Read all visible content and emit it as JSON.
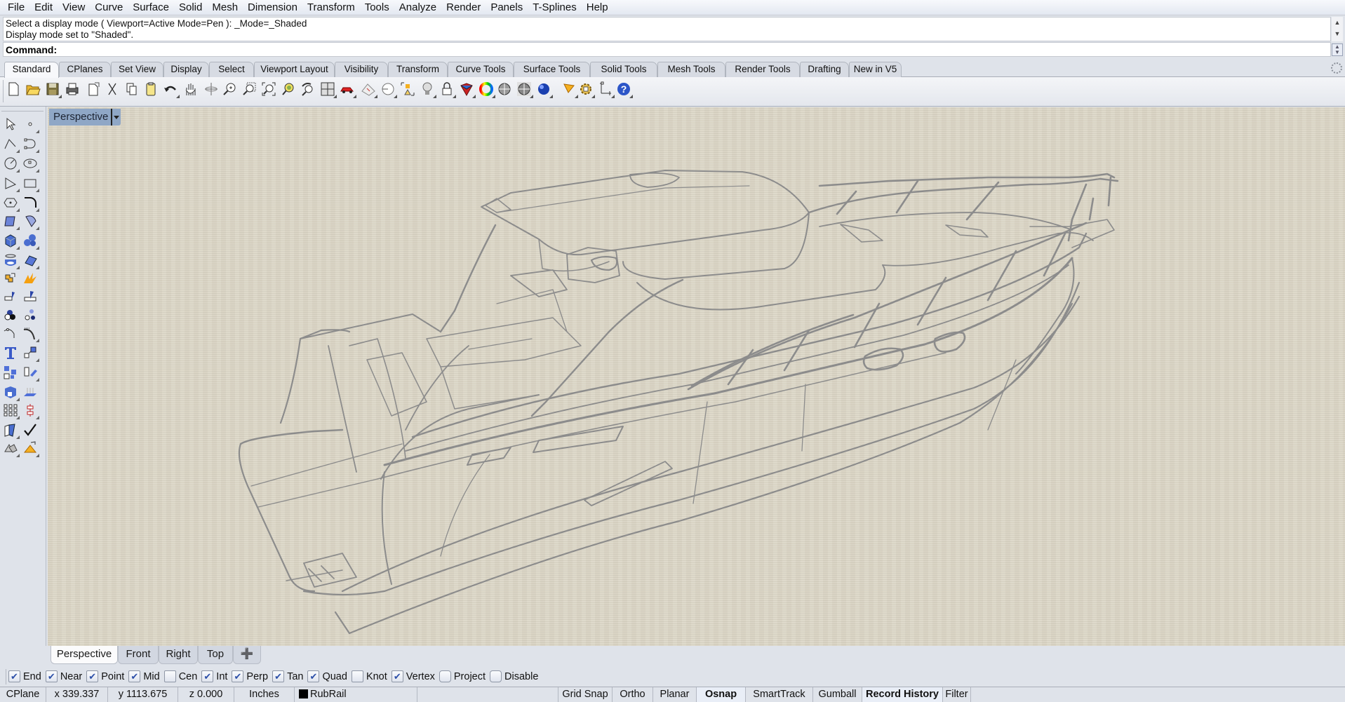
{
  "menu": [
    "File",
    "Edit",
    "View",
    "Curve",
    "Surface",
    "Solid",
    "Mesh",
    "Dimension",
    "Transform",
    "Tools",
    "Analyze",
    "Render",
    "Panels",
    "T-Splines",
    "Help"
  ],
  "command_history": [
    "Select a display mode ( Viewport=Active  Mode=Pen ): _Mode=_Shaded",
    "Display mode set to \"Shaded\"."
  ],
  "command": {
    "label": "Command:",
    "value": ""
  },
  "toolbar_tabs": [
    {
      "label": "Standard",
      "active": true
    },
    {
      "label": "CPlanes"
    },
    {
      "label": "Set View"
    },
    {
      "label": "Display"
    },
    {
      "label": "Select"
    },
    {
      "label": "Viewport Layout"
    },
    {
      "label": "Visibility"
    },
    {
      "label": "Transform"
    },
    {
      "label": "Curve Tools"
    },
    {
      "label": "Surface Tools"
    },
    {
      "label": "Solid Tools"
    },
    {
      "label": "Mesh Tools"
    },
    {
      "label": "Render Tools"
    },
    {
      "label": "Drafting"
    },
    {
      "label": "New in V5"
    }
  ],
  "standard_tools": [
    "new-file",
    "open-file",
    "save-file",
    "print",
    "import",
    "cut",
    "copy",
    "paste",
    "undo",
    "pan",
    "rotate-view",
    "zoom-dynamic",
    "zoom-window",
    "zoom-extents",
    "zoom-selected",
    "undo-view",
    "four-viewports",
    "car-object-properties",
    "grid-options",
    "cplane",
    "select-points",
    "light-bulb",
    "lock",
    "layer",
    "color-wheel",
    "shaded-sphere",
    "rendered-sphere",
    "render-sphere",
    "spotlight",
    "options-gear",
    "dimension",
    "help"
  ],
  "left_tools": [
    "select-arrow",
    "point",
    "polyline",
    "curve-control-points",
    "circle",
    "ellipse",
    "arc",
    "rectangle",
    "polygon",
    "fillet-curves",
    "surface-from-points",
    "surface-loft",
    "box",
    "sphere",
    "cylinder",
    "mesh-surface",
    "boolean-union",
    "explode",
    "trim",
    "split",
    "join-shading",
    "group",
    "offset-curve",
    "blend-curve",
    "text",
    "scale",
    "array",
    "move",
    "extrude-solid",
    "project",
    "grid-array",
    "gumball-points",
    "boolean-tools",
    "check",
    "analyze-solids",
    "render-cone"
  ],
  "viewport": {
    "title": "Perspective",
    "display_mode": "Shaded",
    "background_color": "#dcd6c6",
    "line_color": "#8c8c8c"
  },
  "viewport_tabs": [
    {
      "label": "Perspective",
      "active": true
    },
    {
      "label": "Front"
    },
    {
      "label": "Right"
    },
    {
      "label": "Top"
    }
  ],
  "add_viewport_icon": "plus-icon",
  "osnaps": [
    {
      "label": "End",
      "checked": true
    },
    {
      "label": "Near",
      "checked": true
    },
    {
      "label": "Point",
      "checked": true
    },
    {
      "label": "Mid",
      "checked": true
    },
    {
      "label": "Cen",
      "checked": false
    },
    {
      "label": "Int",
      "checked": true
    },
    {
      "label": "Perp",
      "checked": true
    },
    {
      "label": "Tan",
      "checked": true
    },
    {
      "label": "Quad",
      "checked": true
    },
    {
      "label": "Knot",
      "checked": false
    },
    {
      "label": "Vertex",
      "checked": true
    },
    {
      "label": "Project",
      "checked": false
    },
    {
      "label": "Disable",
      "checked": false
    }
  ],
  "status": {
    "cplane": "CPlane",
    "x": "x 339.337",
    "y": "y 1113.675",
    "z": "z 0.000",
    "units": "Inches",
    "layer": "RubRail",
    "layer_color": "#000000",
    "toggles": [
      {
        "label": "Grid Snap",
        "on": false
      },
      {
        "label": "Ortho",
        "on": false
      },
      {
        "label": "Planar",
        "on": false
      },
      {
        "label": "Osnap",
        "on": true
      },
      {
        "label": "SmartTrack",
        "on": false
      },
      {
        "label": "Gumball",
        "on": false
      },
      {
        "label": "Record History",
        "on": true
      },
      {
        "label": "Filter",
        "on": false
      }
    ]
  }
}
